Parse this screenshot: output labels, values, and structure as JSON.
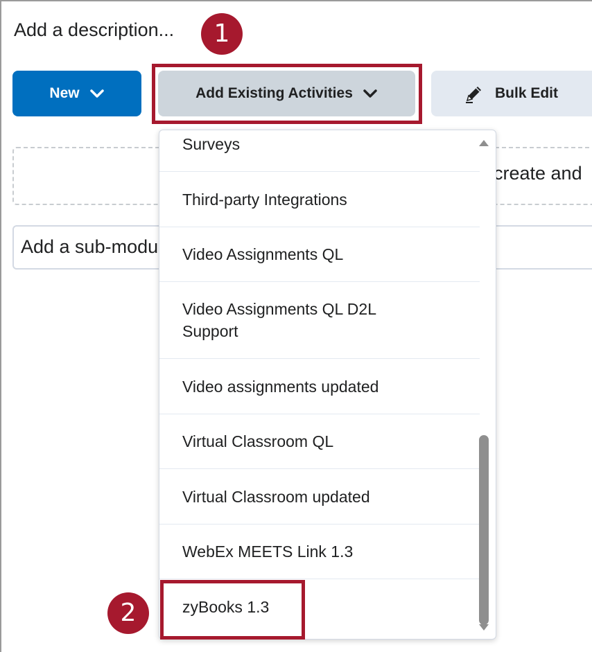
{
  "description_placeholder": "Add a description...",
  "callouts": {
    "first": "1",
    "second": "2"
  },
  "toolbar": {
    "new_label": "New",
    "add_existing_label": "Add Existing Activities",
    "bulk_edit_label": "Bulk Edit"
  },
  "drop_zone_text": "create and",
  "submodule_placeholder": "Add a sub-module...",
  "dropdown": {
    "items": [
      {
        "label": "Surveys"
      },
      {
        "label": "Third-party Integrations"
      },
      {
        "label": "Video Assignments QL"
      },
      {
        "label": "Video Assignments QL D2L Support"
      },
      {
        "label": "Video assignments updated"
      },
      {
        "label": "Virtual Classroom QL"
      },
      {
        "label": "Virtual Classroom updated"
      },
      {
        "label": "WebEx MEETS Link 1.3"
      },
      {
        "label": "zyBooks 1.3"
      }
    ]
  },
  "icons": {
    "chevron": "chevron-down-icon",
    "pencil": "pencil-icon"
  },
  "colors": {
    "primary": "#006fbf",
    "callout": "#a6192e",
    "secondary_button": "#cdd5dc",
    "tertiary_button": "#e3e9f1"
  }
}
